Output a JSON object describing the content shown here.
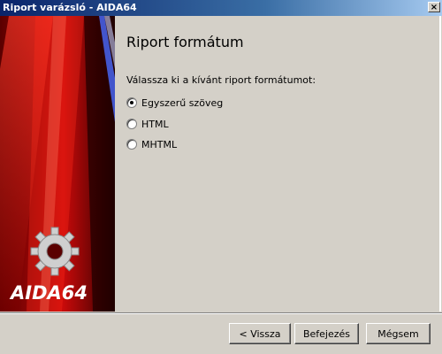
{
  "window": {
    "title": "Riport varázsló - AIDA64",
    "close_glyph": "×"
  },
  "banner": {
    "logo_text": "AIDA64",
    "icon": "gear-icon"
  },
  "page": {
    "title": "Riport formátum",
    "prompt": "Válassza ki a kívánt riport formátumot:",
    "options": [
      {
        "label": "Egyszerű szöveg",
        "selected": true
      },
      {
        "label": "HTML",
        "selected": false
      },
      {
        "label": "MHTML",
        "selected": false
      }
    ]
  },
  "buttons": {
    "back": "< Vissza",
    "finish": "Befejezés",
    "cancel": "Mégsem"
  },
  "colors": {
    "accent": "#0a246a",
    "face": "#d4d0c8",
    "banner_red": "#e01010"
  }
}
